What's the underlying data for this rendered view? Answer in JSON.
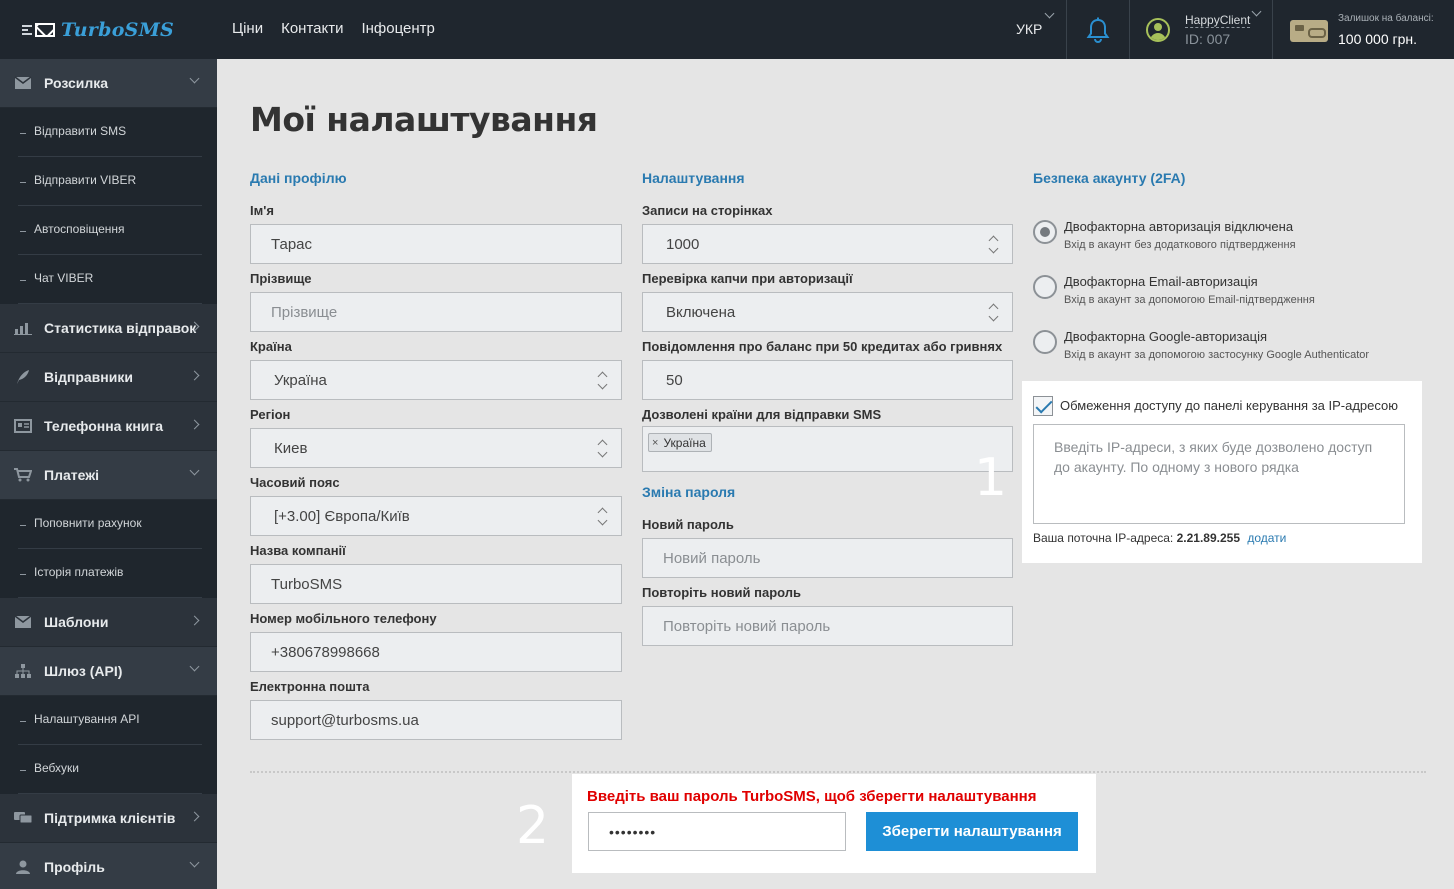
{
  "header": {
    "logo_text": "TurboSMS",
    "nav": [
      "Ціни",
      "Контакти",
      "Інфоцентр"
    ],
    "lang": "УКР",
    "user_name": "HappyClient",
    "user_id": "ID: 007",
    "balance_label": "Залишок на балансі:",
    "balance_value": "100 000 грн."
  },
  "sidebar": {
    "items": [
      {
        "label": "Розсилка",
        "type": "main",
        "icon": "envelope-icon",
        "state": "open"
      },
      {
        "label": "Відправити SMS",
        "type": "sub"
      },
      {
        "label": "Відправити VIBER",
        "type": "sub"
      },
      {
        "label": "Автосповіщення",
        "type": "sub"
      },
      {
        "label": "Чат VIBER",
        "type": "sub"
      },
      {
        "label": "Статистика відправок",
        "type": "main",
        "icon": "chart-icon",
        "state": "closed"
      },
      {
        "label": "Відправники",
        "type": "main",
        "icon": "feather-icon",
        "state": "closed"
      },
      {
        "label": "Телефонна книга",
        "type": "main",
        "icon": "address-book-icon",
        "state": "closed"
      },
      {
        "label": "Платежі",
        "type": "main",
        "icon": "cart-icon",
        "state": "open"
      },
      {
        "label": "Поповнити рахунок",
        "type": "sub"
      },
      {
        "label": "Історія платежів",
        "type": "sub"
      },
      {
        "label": "Шаблони",
        "type": "main",
        "icon": "envelope-icon",
        "state": "closed"
      },
      {
        "label": "Шлюз (API)",
        "type": "main",
        "icon": "sitemap-icon",
        "state": "open"
      },
      {
        "label": "Налаштування API",
        "type": "sub"
      },
      {
        "label": "Вебхуки",
        "type": "sub"
      },
      {
        "label": "Підтримка клієнтів",
        "type": "main",
        "icon": "chat-icon",
        "state": "closed"
      },
      {
        "label": "Профіль",
        "type": "main",
        "icon": "user-icon",
        "state": "open"
      }
    ]
  },
  "page": {
    "title": "Мої налаштування"
  },
  "profile": {
    "heading": "Дані профілю",
    "first_name_label": "Ім'я",
    "first_name_value": "Тарас",
    "last_name_label": "Прізвище",
    "last_name_placeholder": "Прізвище",
    "country_label": "Країна",
    "country_value": "Україна",
    "region_label": "Регіон",
    "region_value": "Киев",
    "timezone_label": "Часовий пояс",
    "timezone_value": "[+3.00] Європа/Київ",
    "company_label": "Назва компанії",
    "company_value": "TurboSMS",
    "phone_label": "Номер мобільного телефону",
    "phone_value": "+380678998668",
    "email_label": "Електронна пошта",
    "email_value": "support@turbosms.ua"
  },
  "settings": {
    "heading": "Налаштування",
    "records_label": "Записи на сторінках",
    "records_value": "1000",
    "captcha_label": "Перевірка капчи при авторизації",
    "captcha_value": "Включена",
    "balance_notify_label": "Повідомлення про баланс при 50 кредитах або гривнях",
    "balance_notify_value": "50",
    "countries_label": "Дозволені країни для відправки SMS",
    "countries_tag_remove": "×",
    "countries_tag": "Україна"
  },
  "password_change": {
    "heading": "Зміна пароля",
    "new_label": "Новий пароль",
    "new_placeholder": "Новий пароль",
    "repeat_label": "Повторіть новий пароль",
    "repeat_placeholder": "Повторіть новий пароль"
  },
  "security": {
    "heading": "Безпека акаунту (2FA)",
    "options": [
      {
        "title": "Двофакторна авторизація відключена",
        "sub": "Вхід в акаунт без додаткового підтвердження",
        "selected": true
      },
      {
        "title": "Двофакторна Email-авторизація",
        "sub": "Вхід в акаунт за допомогою Email-підтвердження",
        "selected": false
      },
      {
        "title": "Двофакторна Google-авторизація",
        "sub": "Вхід в акаунт за допомогою застосунку Google Authenticator",
        "selected": false
      }
    ],
    "ip_restrict_label": "Обмеження доступу до панелі керування за IP-адресою",
    "ip_restrict_checked": true,
    "ip_textarea_placeholder": "Введіть IP-адреси, з яких буде дозволено доступ до акаунту. По одному з нового рядка",
    "current_ip_label": "Ваша поточна IP-адреса:",
    "current_ip_value": "2.21.89.255",
    "add_link": "додати"
  },
  "annotations": {
    "marker_1": "1",
    "marker_2": "2"
  },
  "footer": {
    "warning": "Введіть ваш пароль TurboSMS, щоб зберегти налаштування",
    "password_value": "••••••••",
    "save_label": "Зберегти налаштування"
  },
  "colors": {
    "topbar_bg": "#1f262e",
    "sidebar_bg": "#2c333b",
    "content_bg": "#e5e5e5",
    "accent_blue": "#2a7ab0",
    "button_blue": "#1e8fd6",
    "warning_red": "#e00000"
  }
}
